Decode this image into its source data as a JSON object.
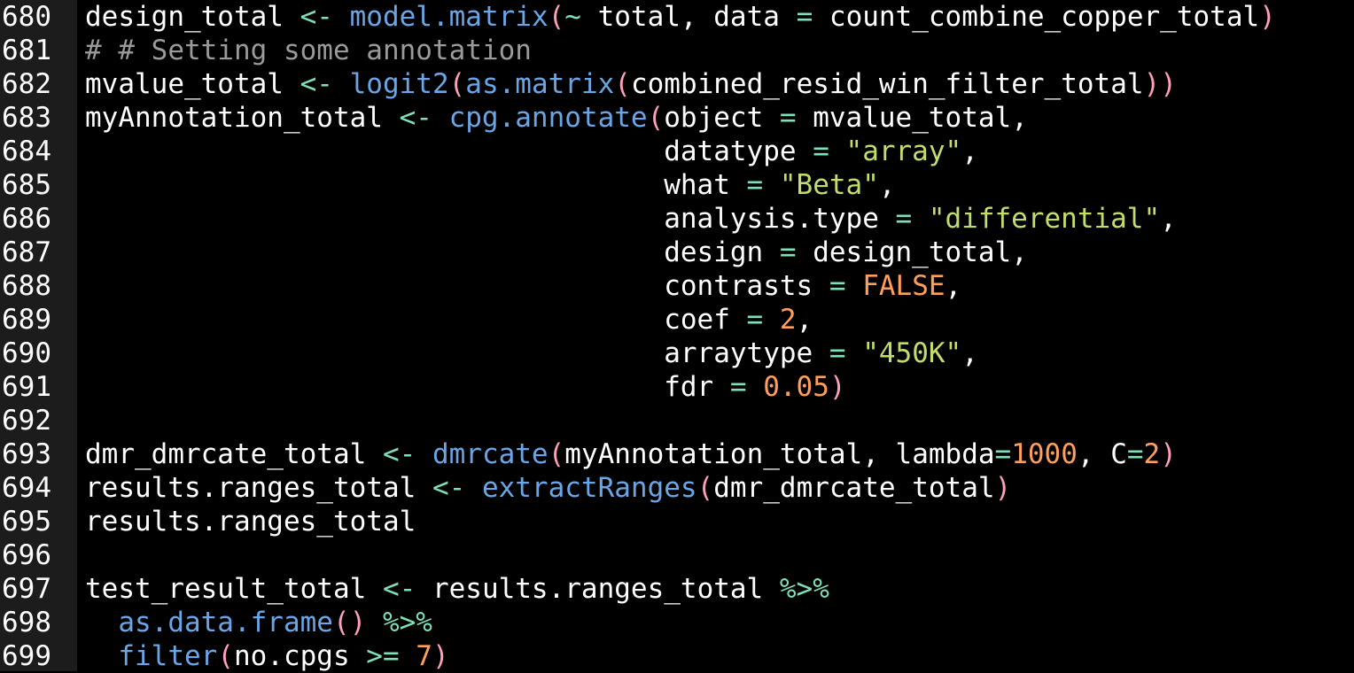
{
  "editor": {
    "lines": [
      {
        "number": "680",
        "tokens": [
          {
            "t": "design_total ",
            "c": "plain"
          },
          {
            "t": "<- ",
            "c": "op"
          },
          {
            "t": "model.matrix",
            "c": "fn"
          },
          {
            "t": "(",
            "c": "paren"
          },
          {
            "t": "~ ",
            "c": "op"
          },
          {
            "t": "total, data ",
            "c": "plain"
          },
          {
            "t": "= ",
            "c": "op"
          },
          {
            "t": "count_combine_copper_total",
            "c": "plain"
          },
          {
            "t": ")",
            "c": "paren"
          }
        ]
      },
      {
        "number": "681",
        "tokens": [
          {
            "t": "# # Setting some annotation",
            "c": "comment"
          }
        ]
      },
      {
        "number": "682",
        "tokens": [
          {
            "t": "mvalue_total ",
            "c": "plain"
          },
          {
            "t": "<- ",
            "c": "op"
          },
          {
            "t": "logit2",
            "c": "fn"
          },
          {
            "t": "(",
            "c": "paren"
          },
          {
            "t": "as.matrix",
            "c": "fn"
          },
          {
            "t": "(",
            "c": "paren"
          },
          {
            "t": "combined_resid_win_filter_total",
            "c": "plain"
          },
          {
            "t": "))",
            "c": "paren"
          }
        ]
      },
      {
        "number": "683",
        "tokens": [
          {
            "t": "myAnnotation_total ",
            "c": "plain"
          },
          {
            "t": "<- ",
            "c": "op"
          },
          {
            "t": "cpg.annotate",
            "c": "fn"
          },
          {
            "t": "(",
            "c": "paren"
          },
          {
            "t": "object ",
            "c": "plain"
          },
          {
            "t": "= ",
            "c": "op"
          },
          {
            "t": "mvalue_total,",
            "c": "plain"
          }
        ]
      },
      {
        "number": "684",
        "tokens": [
          {
            "t": "                                   datatype ",
            "c": "plain"
          },
          {
            "t": "= ",
            "c": "op"
          },
          {
            "t": "\"array\"",
            "c": "str"
          },
          {
            "t": ",",
            "c": "plain"
          }
        ]
      },
      {
        "number": "685",
        "tokens": [
          {
            "t": "                                   what ",
            "c": "plain"
          },
          {
            "t": "= ",
            "c": "op"
          },
          {
            "t": "\"Beta\"",
            "c": "str"
          },
          {
            "t": ",",
            "c": "plain"
          }
        ]
      },
      {
        "number": "686",
        "tokens": [
          {
            "t": "                                   analysis.type ",
            "c": "plain"
          },
          {
            "t": "= ",
            "c": "op"
          },
          {
            "t": "\"differential\"",
            "c": "str"
          },
          {
            "t": ",",
            "c": "plain"
          }
        ]
      },
      {
        "number": "687",
        "tokens": [
          {
            "t": "                                   design ",
            "c": "plain"
          },
          {
            "t": "= ",
            "c": "op"
          },
          {
            "t": "design_total,",
            "c": "plain"
          }
        ]
      },
      {
        "number": "688",
        "tokens": [
          {
            "t": "                                   contrasts ",
            "c": "plain"
          },
          {
            "t": "= ",
            "c": "op"
          },
          {
            "t": "FALSE",
            "c": "kw"
          },
          {
            "t": ",",
            "c": "plain"
          }
        ]
      },
      {
        "number": "689",
        "tokens": [
          {
            "t": "                                   coef ",
            "c": "plain"
          },
          {
            "t": "= ",
            "c": "op"
          },
          {
            "t": "2",
            "c": "num"
          },
          {
            "t": ",",
            "c": "plain"
          }
        ]
      },
      {
        "number": "690",
        "tokens": [
          {
            "t": "                                   arraytype ",
            "c": "plain"
          },
          {
            "t": "= ",
            "c": "op"
          },
          {
            "t": "\"450K\"",
            "c": "str"
          },
          {
            "t": ",",
            "c": "plain"
          }
        ]
      },
      {
        "number": "691",
        "tokens": [
          {
            "t": "                                   fdr ",
            "c": "plain"
          },
          {
            "t": "= ",
            "c": "op"
          },
          {
            "t": "0.05",
            "c": "num"
          },
          {
            "t": ")",
            "c": "paren"
          }
        ]
      },
      {
        "number": "692",
        "tokens": []
      },
      {
        "number": "693",
        "tokens": [
          {
            "t": "dmr_dmrcate_total ",
            "c": "plain"
          },
          {
            "t": "<- ",
            "c": "op"
          },
          {
            "t": "dmrcate",
            "c": "fn"
          },
          {
            "t": "(",
            "c": "paren"
          },
          {
            "t": "myAnnotation_total, lambda",
            "c": "plain"
          },
          {
            "t": "=",
            "c": "op"
          },
          {
            "t": "1000",
            "c": "num"
          },
          {
            "t": ", C",
            "c": "plain"
          },
          {
            "t": "=",
            "c": "op"
          },
          {
            "t": "2",
            "c": "num"
          },
          {
            "t": ")",
            "c": "paren"
          }
        ]
      },
      {
        "number": "694",
        "tokens": [
          {
            "t": "results.ranges_total ",
            "c": "plain"
          },
          {
            "t": "<- ",
            "c": "op"
          },
          {
            "t": "extractRanges",
            "c": "fn"
          },
          {
            "t": "(",
            "c": "paren"
          },
          {
            "t": "dmr_dmrcate_total",
            "c": "plain"
          },
          {
            "t": ")",
            "c": "paren"
          }
        ]
      },
      {
        "number": "695",
        "tokens": [
          {
            "t": "results.ranges_total",
            "c": "plain"
          }
        ]
      },
      {
        "number": "696",
        "tokens": []
      },
      {
        "number": "697",
        "tokens": [
          {
            "t": "test_result_total ",
            "c": "plain"
          },
          {
            "t": "<- ",
            "c": "op"
          },
          {
            "t": "results.ranges_total ",
            "c": "plain"
          },
          {
            "t": "%>%",
            "c": "op"
          }
        ]
      },
      {
        "number": "698",
        "tokens": [
          {
            "t": "  ",
            "c": "plain"
          },
          {
            "t": "as.data.frame",
            "c": "fn"
          },
          {
            "t": "() ",
            "c": "paren"
          },
          {
            "t": "%>%",
            "c": "op"
          }
        ]
      },
      {
        "number": "699",
        "tokens": [
          {
            "t": "  ",
            "c": "plain"
          },
          {
            "t": "filter",
            "c": "fn"
          },
          {
            "t": "(",
            "c": "paren"
          },
          {
            "t": "no.cpgs ",
            "c": "plain"
          },
          {
            "t": ">= ",
            "c": "op"
          },
          {
            "t": "7",
            "c": "num"
          },
          {
            "t": ")",
            "c": "paren"
          }
        ]
      }
    ]
  }
}
